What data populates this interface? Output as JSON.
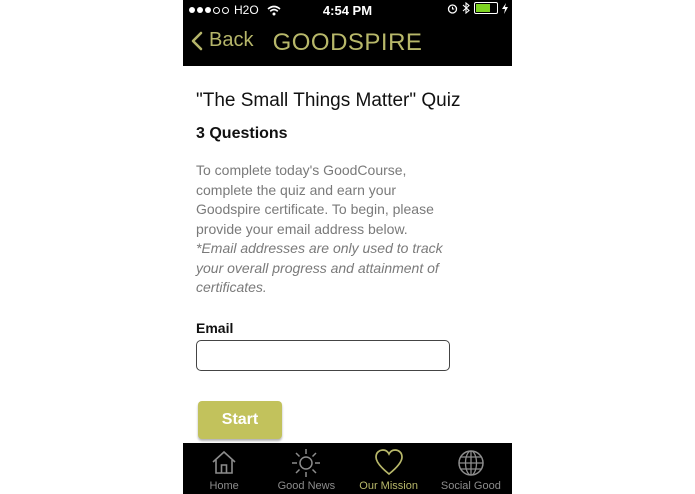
{
  "status_bar": {
    "carrier": "H2O",
    "time": "4:54 PM"
  },
  "nav": {
    "back_label": "Back",
    "brand": "GOODSPIRE"
  },
  "quiz": {
    "title": "\"The Small Things Matter\" Quiz",
    "question_count": "3 Questions",
    "intro": "To complete today's GoodCourse, complete the quiz and earn your Goodspire certificate. To begin, please provide your email address below.",
    "note": "*Email addresses are only used to track your overall progress and attainment of certificates.",
    "email_label": "Email",
    "email_value": "",
    "start_label": "Start"
  },
  "tabs": [
    {
      "label": "Home",
      "icon": "home-icon"
    },
    {
      "label": "Good News",
      "icon": "sun-icon"
    },
    {
      "label": "Our Mission",
      "icon": "heart-icon",
      "active": true
    },
    {
      "label": "Social Good",
      "icon": "globe-icon"
    }
  ],
  "colors": {
    "accent": "#b8b86a",
    "button": "#c2c25c",
    "bar": "#000000"
  }
}
